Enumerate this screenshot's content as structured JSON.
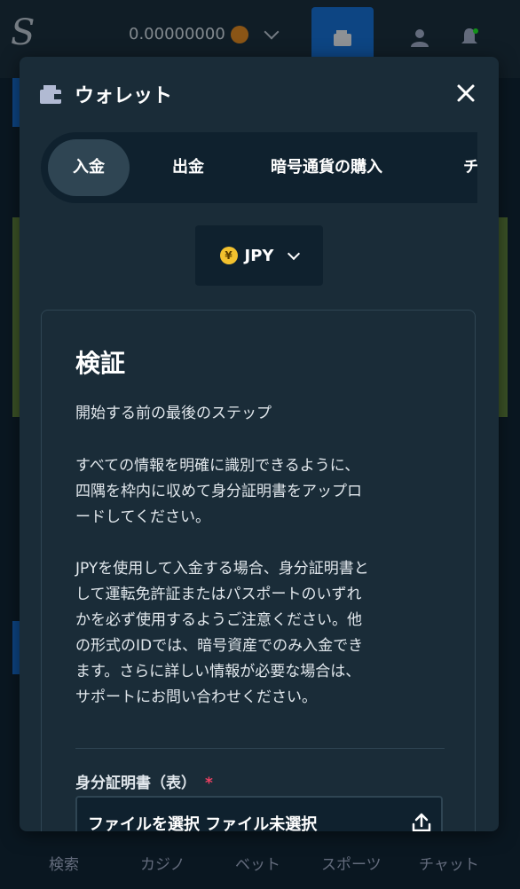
{
  "app": {
    "logo": "S",
    "balance": "0.00000000"
  },
  "bottom_nav": [
    {
      "label": "検索"
    },
    {
      "label": "カジノ"
    },
    {
      "label": "ベット"
    },
    {
      "label": "スポーツ"
    },
    {
      "label": "チャット"
    }
  ],
  "modal": {
    "title": "ウォレット",
    "tabs": [
      {
        "label": "入金",
        "active": true
      },
      {
        "label": "出金"
      },
      {
        "label": "暗号通貨の購入"
      },
      {
        "label": "チ"
      }
    ],
    "currency": {
      "symbol": "¥",
      "code": "JPY"
    },
    "verification": {
      "title": "検証",
      "subtitle": "開始する前の最後のステップ",
      "instructions_1": "すべての情報を明確に識別できるように、",
      "instructions_2": "四隅を枠内に収めて身分証明書をアップロ",
      "instructions_3": "ードしてください。",
      "notice_1": "JPYを使用して入金する場合、身分証明書と",
      "notice_2": "して運転免許証またはパスポートのいずれ",
      "notice_3": "かを必ず使用するようご注意ください。他",
      "notice_4": "の形式のIDでは、暗号資産でのみ入金でき",
      "notice_5": "ます。さらに詳しい情報が必要な場合は、",
      "notice_6": "サポートにお問い合わせください。",
      "field_label": "身分証明書（表）",
      "required_mark": "*",
      "file_button": "ファイルを選択",
      "file_status": "ファイル未選択"
    }
  },
  "colors": {
    "background": "#0f212e",
    "panel": "#1a2c38",
    "accent_blue": "#1475e1",
    "required": "#ed4163"
  }
}
